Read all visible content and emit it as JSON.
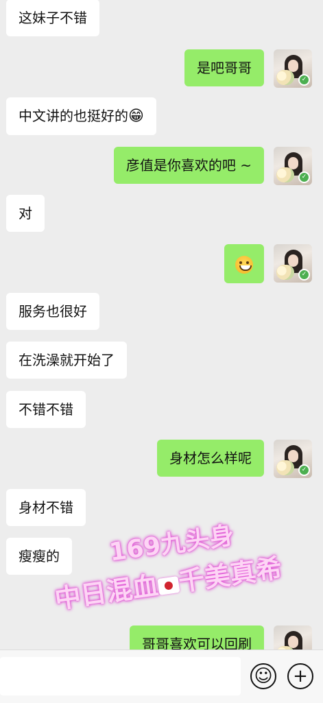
{
  "messages": [
    {
      "side": "in",
      "text": "这妹子不错"
    },
    {
      "side": "out",
      "text": "是吧哥哥"
    },
    {
      "side": "in",
      "text": "中文讲的也挺好的",
      "emoji": "😁"
    },
    {
      "side": "out",
      "text": "彦值是你喜欢的吧 ~"
    },
    {
      "side": "in",
      "text": "对"
    },
    {
      "side": "out",
      "emoji": "grinning-face"
    },
    {
      "side": "in",
      "text": "服务也很好"
    },
    {
      "side": "in",
      "text": "在洗澡就开始了"
    },
    {
      "side": "in",
      "text": "不错不错"
    },
    {
      "side": "out",
      "text": "身材怎么样呢"
    },
    {
      "side": "in",
      "text": "身材不错"
    },
    {
      "side": "in",
      "text": "瘦瘦的"
    },
    {
      "side": "out",
      "text": "哥哥喜欢可以回刷"
    }
  ],
  "overlay": {
    "line1": "169九头身",
    "line2_left": "中日混血",
    "line2_right": "千美真希",
    "flag_icon": "japan-flag"
  },
  "input_bar": {
    "emoji_icon": "☺",
    "plus_icon": "+"
  },
  "colors": {
    "background": "#ededed",
    "incoming": "#ffffff",
    "outgoing": "#95ec69",
    "overlay_glow": "#e45ad8"
  }
}
